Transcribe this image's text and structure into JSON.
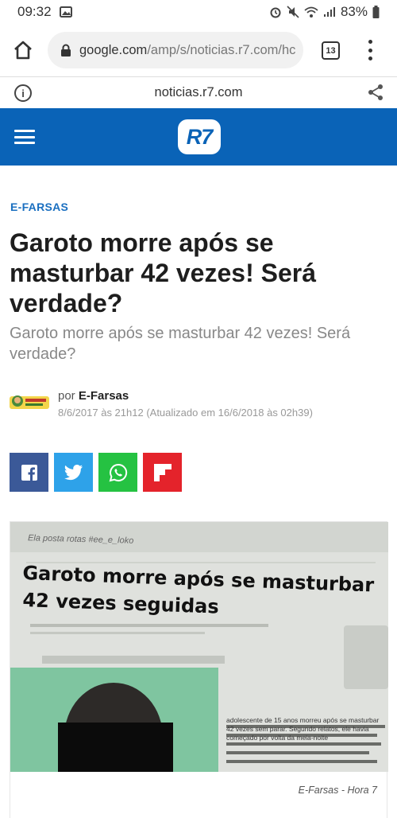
{
  "status_bar": {
    "time": "09:32",
    "battery": "83%"
  },
  "browser": {
    "url_host": "google.com",
    "url_path": "/amp/s/noticias.r7.com/hc",
    "tab_count": "13",
    "amp_domain": "noticias.r7.com"
  },
  "site": {
    "logo_text": "R7",
    "brand_color": "#0a63b7"
  },
  "article": {
    "category": "E-FARSAS",
    "headline": "Garoto morre após se masturbar 42 vezes! Será verdade?",
    "subheadline": "Garoto morre após se masturbar 42 vezes! Será verdade?",
    "author_prefix": "por",
    "author_name": "E-Farsas",
    "date": "8/6/2017 às 21h12 (Atualizado em 16/6/2018 às 02h39)",
    "photo_text_top": "Ela posta rotas #ee_e_loko",
    "photo_headline_line1": "Garoto morre após se masturbar",
    "photo_headline_line2": "42 vezes seguidas",
    "photo_side_text": "adolescente de 15 anos morreu após se masturbar 42 vezes sem parar. Segundo relatos, ele havia começado por volta da meia-noite",
    "photo_caption": "E-Farsas - Hora 7"
  },
  "share": {
    "facebook": "facebook-icon",
    "twitter": "twitter-icon",
    "whatsapp": "whatsapp-icon",
    "flipboard": "flipboard-icon"
  }
}
